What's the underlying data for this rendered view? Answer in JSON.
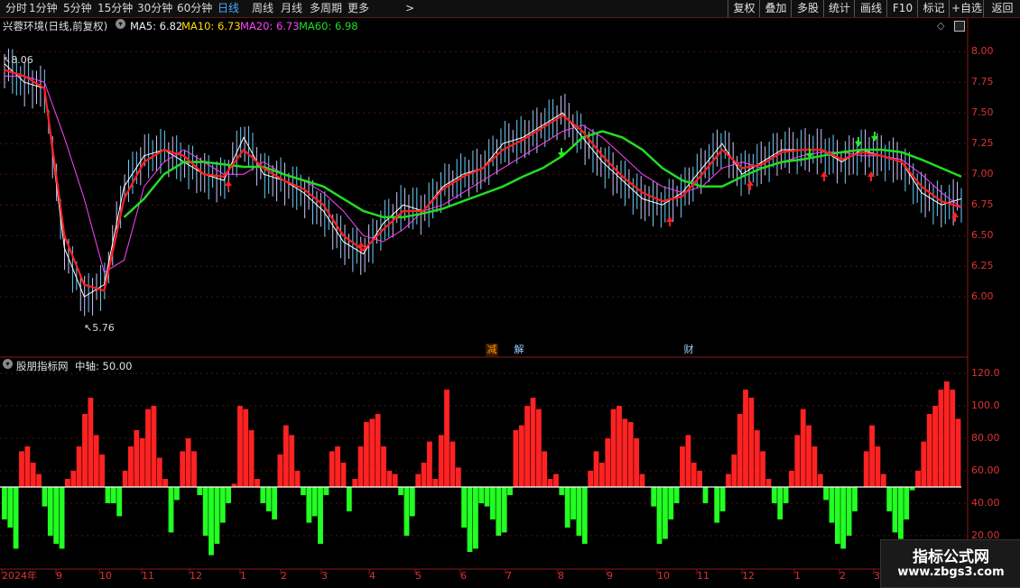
{
  "toolbar": {
    "periods": [
      "分时",
      "1分钟",
      "5分钟",
      "15分钟",
      "30分钟",
      "60分钟",
      "日线",
      "周线",
      "月线",
      "多周期",
      "更多"
    ],
    "active_period": "日线",
    "more_arrow": ">",
    "right_buttons": [
      "复权",
      "叠加",
      "多股",
      "统计",
      "画线",
      "F10",
      "标记",
      "+自选",
      "返回"
    ]
  },
  "main_panel": {
    "stock_title": "兴蓉环境(日线,前复权)",
    "ma5_label": "MA5: 6.82",
    "ma10_label": "MA10: 6.73",
    "ma20_label": "MA20: 6.73",
    "ma60_label": "MA60: 6.98",
    "high_annotation": "8.06",
    "low_annotation": "5.76",
    "events": [
      "减",
      "解",
      "财"
    ],
    "colors": {
      "ma5": "#ffffff",
      "ma10": "#ffdd00",
      "ma20": "#ff44ff",
      "ma60": "#22dd22",
      "up": "#ff2222",
      "down": "#22ff22",
      "axis": "#dd3333"
    }
  },
  "sub_panel": {
    "indicator_name": "股朋指标网",
    "axis_label": "中轴: 50.00"
  },
  "chart_data": [
    {
      "type": "line",
      "ylim": [
        5.7,
        8.2
      ],
      "y_ticks": [
        "8.00",
        "7.75",
        "7.50",
        "7.25",
        "7.00",
        "6.75",
        "6.50",
        "6.25",
        "6.00"
      ],
      "x_ticks": [
        "2024年",
        "9",
        "10",
        "11",
        "12",
        "1",
        "2",
        "3",
        "4",
        "5",
        "6",
        "7",
        "8",
        "9",
        "10",
        "11",
        "12",
        "1",
        "2",
        "3"
      ],
      "series": [
        {
          "name": "MA5",
          "values": [
            7.9,
            7.75,
            7.7,
            6.4,
            6.0,
            6.1,
            6.9,
            7.15,
            7.2,
            7.1,
            7.0,
            6.95,
            7.3,
            7.0,
            6.95,
            6.85,
            6.7,
            6.45,
            6.35,
            6.6,
            6.75,
            6.7,
            6.9,
            7.0,
            7.05,
            7.25,
            7.3,
            7.4,
            7.5,
            7.3,
            7.1,
            6.95,
            6.8,
            6.75,
            6.85,
            7.05,
            7.25,
            7.0,
            7.1,
            7.2,
            7.2,
            7.2,
            7.1,
            7.2,
            7.15,
            7.1,
            6.85,
            6.75,
            6.8
          ]
        },
        {
          "name": "MA10",
          "values": [
            7.85,
            7.8,
            7.7,
            6.5,
            6.1,
            6.05,
            6.8,
            7.1,
            7.2,
            7.15,
            7.0,
            6.98,
            7.2,
            7.05,
            6.95,
            6.88,
            6.75,
            6.5,
            6.38,
            6.55,
            6.7,
            6.7,
            6.88,
            6.98,
            7.05,
            7.2,
            7.28,
            7.38,
            7.48,
            7.35,
            7.15,
            6.98,
            6.85,
            6.78,
            6.82,
            7.0,
            7.2,
            7.05,
            7.08,
            7.18,
            7.2,
            7.2,
            7.12,
            7.18,
            7.15,
            7.1,
            6.9,
            6.78,
            6.73
          ]
        },
        {
          "name": "MA20",
          "values": [
            7.8,
            7.8,
            7.75,
            7.3,
            6.8,
            6.2,
            6.3,
            6.9,
            7.1,
            7.2,
            7.1,
            7.0,
            7.0,
            7.1,
            7.0,
            6.95,
            6.85,
            6.7,
            6.5,
            6.45,
            6.55,
            6.7,
            6.75,
            6.85,
            6.95,
            7.05,
            7.15,
            7.25,
            7.35,
            7.4,
            7.3,
            7.15,
            7.0,
            6.9,
            6.85,
            6.9,
            7.05,
            7.1,
            7.05,
            7.1,
            7.15,
            7.18,
            7.18,
            7.15,
            7.15,
            7.12,
            7.0,
            6.85,
            6.73
          ]
        },
        {
          "name": "MA60",
          "values": [
            null,
            null,
            null,
            null,
            null,
            null,
            6.65,
            6.8,
            7.0,
            7.1,
            7.1,
            7.08,
            7.06,
            7.06,
            7.0,
            6.95,
            6.9,
            6.8,
            6.7,
            6.65,
            6.65,
            6.68,
            6.72,
            6.78,
            6.84,
            6.9,
            6.98,
            7.05,
            7.15,
            7.3,
            7.35,
            7.3,
            7.2,
            7.05,
            6.95,
            6.9,
            6.9,
            6.98,
            7.05,
            7.1,
            7.12,
            7.15,
            7.18,
            7.2,
            7.2,
            7.18,
            7.12,
            7.05,
            6.98
          ]
        }
      ]
    },
    {
      "type": "bar",
      "ylim": [
        0,
        125
      ],
      "baseline": 50,
      "y_ticks": [
        "120.0",
        "100.0",
        "80.00",
        "60.00",
        "40.00",
        "20.00"
      ],
      "values": [
        30,
        25,
        12,
        72,
        75,
        65,
        58,
        38,
        20,
        15,
        12,
        55,
        60,
        75,
        95,
        105,
        82,
        70,
        40,
        40,
        32,
        60,
        75,
        85,
        80,
        98,
        100,
        68,
        55,
        22,
        42,
        72,
        80,
        72,
        45,
        20,
        8,
        15,
        28,
        40,
        52,
        100,
        98,
        85,
        55,
        40,
        35,
        30,
        70,
        88,
        82,
        60,
        45,
        28,
        32,
        15,
        45,
        72,
        75,
        65,
        35,
        55,
        75,
        90,
        92,
        95,
        75,
        60,
        58,
        45,
        20,
        32,
        58,
        65,
        78,
        55,
        82,
        110,
        78,
        62,
        25,
        10,
        12,
        40,
        38,
        30,
        20,
        22,
        45,
        85,
        88,
        100,
        105,
        98,
        72,
        55,
        58,
        45,
        25,
        30,
        20,
        15,
        60,
        72,
        65,
        80,
        98,
        100,
        92,
        90,
        80,
        58,
        50,
        38,
        15,
        18,
        30,
        40,
        75,
        82,
        65,
        60,
        40,
        50,
        28,
        35,
        58,
        70,
        95,
        110,
        105,
        85,
        72,
        55,
        40,
        30,
        40,
        60,
        82,
        98,
        88,
        75,
        58,
        42,
        28,
        15,
        12,
        20,
        35,
        50,
        72,
        88,
        75,
        58,
        35,
        22,
        18,
        30,
        48,
        60,
        78,
        95,
        100,
        110,
        115,
        110,
        92
      ]
    }
  ]
}
